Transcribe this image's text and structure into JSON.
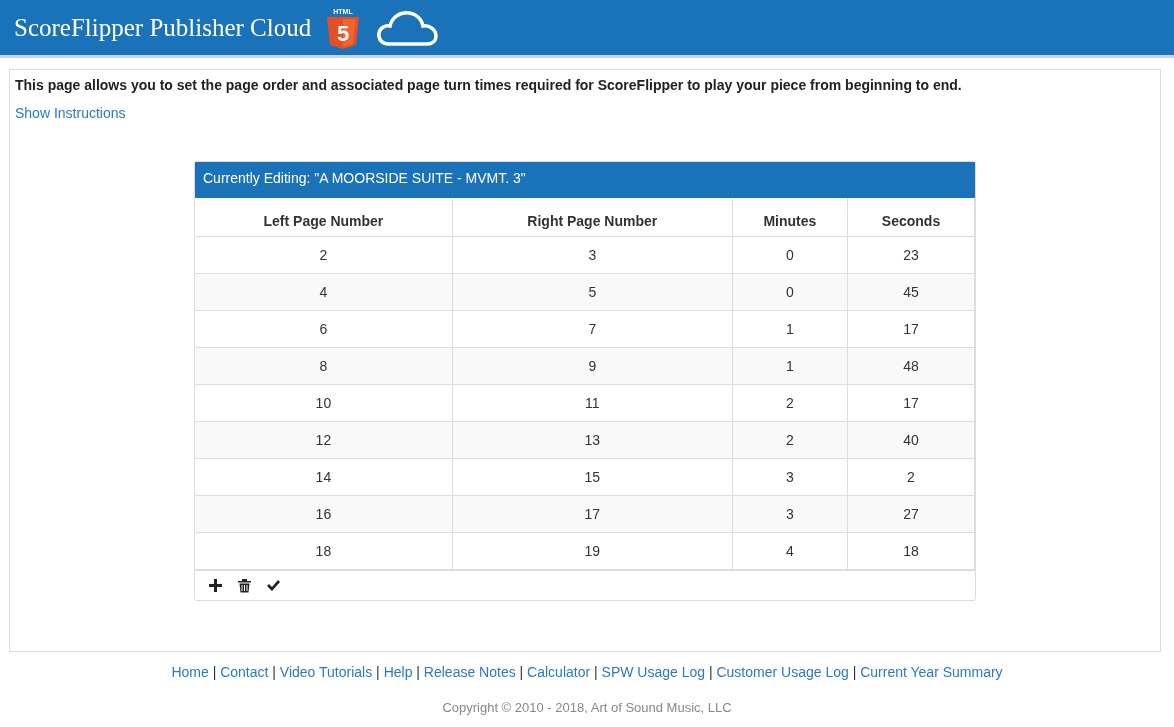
{
  "header": {
    "title": "ScoreFlipper Publisher Cloud",
    "html5_logo": {
      "label": "HTML",
      "numeral": "5"
    }
  },
  "intro": "This page allows you to set the page order and associated page turn times required for ScoreFlipper to play your piece from beginning to end.",
  "instructions_link": "Show Instructions",
  "editor": {
    "title": "Currently Editing: \"A MOORSIDE SUITE - MVMT. 3\"",
    "columns": [
      "Left Page Number",
      "Right Page Number",
      "Minutes",
      "Seconds"
    ],
    "rows": [
      [
        "2",
        "3",
        "0",
        "23"
      ],
      [
        "4",
        "5",
        "0",
        "45"
      ],
      [
        "6",
        "7",
        "1",
        "17"
      ],
      [
        "8",
        "9",
        "1",
        "48"
      ],
      [
        "10",
        "11",
        "2",
        "17"
      ],
      [
        "12",
        "13",
        "2",
        "40"
      ],
      [
        "14",
        "15",
        "3",
        "2"
      ],
      [
        "16",
        "17",
        "3",
        "27"
      ],
      [
        "18",
        "19",
        "4",
        "18"
      ]
    ],
    "toolbar": [
      {
        "kind": "add"
      },
      {
        "kind": "delete"
      },
      {
        "kind": "confirm"
      }
    ]
  },
  "footer": {
    "links": [
      "Home",
      "Contact",
      "Video Tutorials",
      "Help",
      "Release Notes",
      "Calculator",
      "SPW Usage Log",
      "Customer Usage Log",
      "Current Year Summary"
    ],
    "separator": "|",
    "copyright": "Copyright © 2010 - 2018, Art of Sound Music, LLC"
  }
}
